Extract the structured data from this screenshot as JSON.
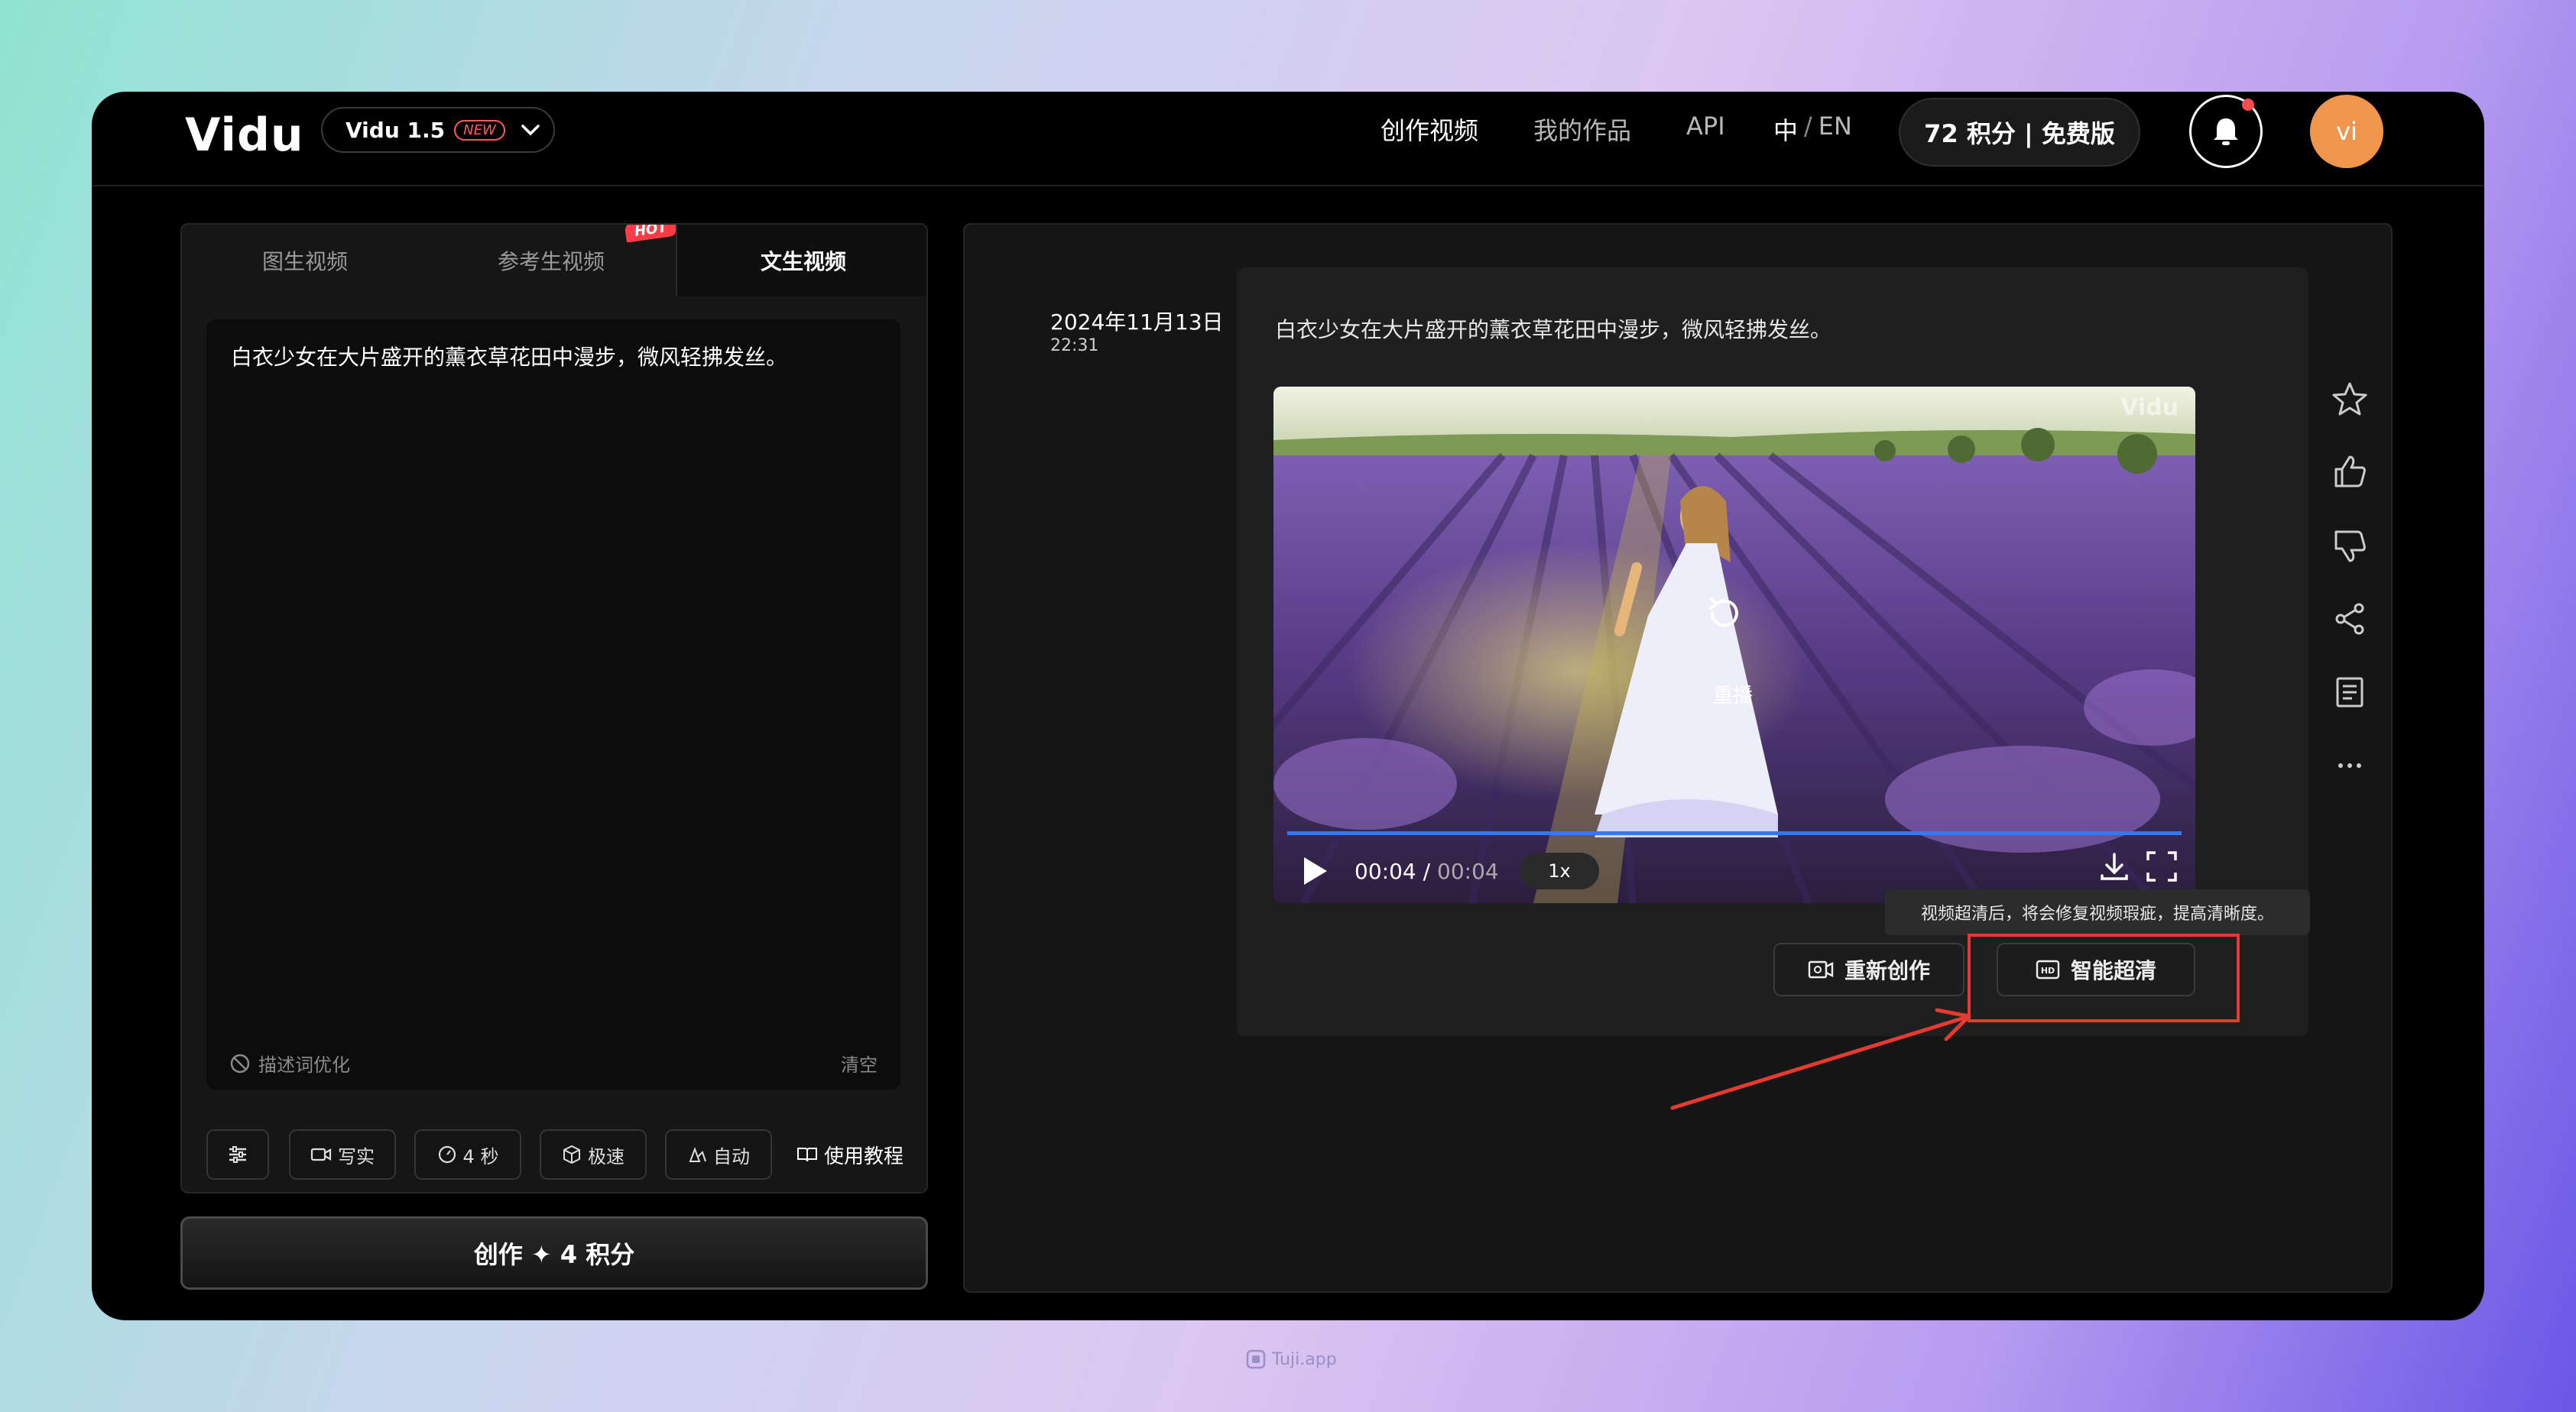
{
  "header": {
    "logo": "Vidu",
    "version": "Vidu 1.5",
    "version_badge": "NEW",
    "nav": [
      "创作视频",
      "我的作品",
      "API"
    ],
    "lang_zh": "中",
    "lang_sep": "/",
    "lang_en": "EN",
    "credits": "72 积分 | 免费版",
    "avatar": "vi"
  },
  "tabs": [
    {
      "label": "图生视频",
      "active": false
    },
    {
      "label": "参考生视频",
      "active": false,
      "badge": "HOT"
    },
    {
      "label": "文生视频",
      "active": true
    }
  ],
  "prompt": {
    "text": "白衣少女在大片盛开的薰衣草花田中漫步，微风轻拂发丝。",
    "optimize_label": "描述词优化",
    "clear_label": "清空"
  },
  "tools": {
    "style": "写实",
    "duration": "4 秒",
    "speed": "极速",
    "motion": "自动",
    "tutorial": "使用教程"
  },
  "create_button": "创作 ✦ 4 积分",
  "result": {
    "date": "2024年11月13日",
    "time": "22:31",
    "prompt": "白衣少女在大片盛开的薰衣草花田中漫步，微风轻拂发丝。",
    "watermark": "Vidu",
    "replay_label": "重播",
    "current_time": "00:04",
    "time_sep": "/",
    "total_time": "00:04",
    "speed": "1x",
    "progress": 1.0,
    "tooltip": "视频超清后，将会修复视频瑕疵，提高清晰度。",
    "recreate_label": "重新创作",
    "upscale_label": "智能超清"
  },
  "watermark_site": "Tuji.app",
  "colors": {
    "accent_orange": "#f0964c",
    "highlight_red": "#e53a2f",
    "progress_blue": "#2f7bff",
    "hot_red": "#ff3b46"
  }
}
